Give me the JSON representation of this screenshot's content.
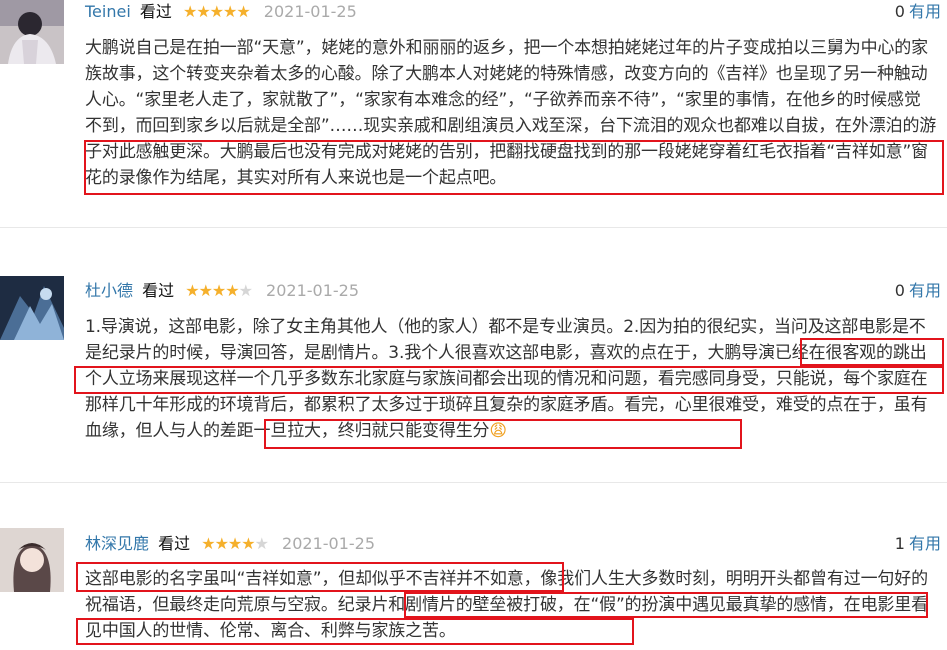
{
  "reviews": [
    {
      "user": "Teinei",
      "status": "看过",
      "rating": 5,
      "date": "2021-01-25",
      "useful_count": "0",
      "useful_label": "有用",
      "text": "大鹏说自己是在拍一部“天意”，姥姥的意外和丽丽的返乡，把一个本想拍姥姥过年的片子变成拍以三舅为中心的家族故事，这个转变夹杂着太多的心酸。除了大鹏本人对姥姥的特殊情感，改变方向的《吉祥》也呈现了另一种触动人心。“家里老人走了，家就散了”，“家家有本难念的经”，“子欲养而亲不待”，“家里的事情，在他乡的时候感觉不到，而回到家乡以后就是全部”……现实亲戚和剧组演员入戏至深，台下流泪的观众也都难以自拔，在外漂泊的游子对此感触更深。大鹏最后也没有完成对姥姥的告别，把翻找硬盘找到的那一段姥姥穿着红毛衣指着“吉祥如意”窗花的录像作为结尾，其实对所有人来说也是一个起点吧。"
    },
    {
      "user": "杜小德",
      "status": "看过",
      "rating": 4,
      "date": "2021-01-25",
      "useful_count": "0",
      "useful_label": "有用",
      "text": "1.导演说，这部电影，除了女主角其他人（他的家人）都不是专业演员。2.因为拍的很纪实，当问及这部电影是不是纪录片的时候，导演回答，是剧情片。3.我个人很喜欢这部电影，喜欢的点在于，大鹏导演已经在很客观的跳出个人立场来展现这样一个几乎多数东北家庭与家族间都会出现的情况和问题，看完感同身受，只能说，每个家庭在那样几十年形成的环境背后，都累积了太多过于琐碎且复杂的家庭矛盾。看完，心里很难受，难受的点在于，虽有血缘，但人与人的差距一旦拉大，终归就只能变得生分",
      "emoji": "😩"
    },
    {
      "user": "林深见鹿",
      "status": "看过",
      "rating": 4,
      "date": "2021-01-25",
      "useful_count": "1",
      "useful_label": "有用",
      "text": "这部电影的名字虽叫“吉祥如意”，但却似乎不吉祥并不如意，像我们人生大多数时刻，明明开头都曾有过一句好的祝福语，但最终走向荒原与空寂。纪录片和剧情片的壁垒被打破，在“假”的扮演中遇见最真挚的感情，在电影里看见中国人的世情、伦常、离合、利弊与家族之苦。"
    }
  ],
  "colors": {
    "link": "#3377aa",
    "star": "#f5b02c",
    "highlight": "#e2141c"
  }
}
